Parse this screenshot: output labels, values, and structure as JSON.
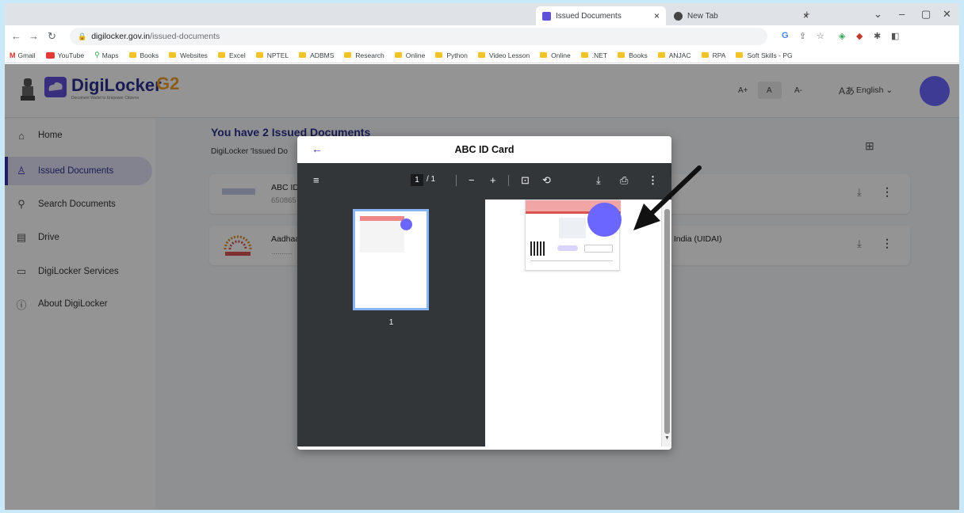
{
  "browser": {
    "tabs": [
      {
        "title": "Issued Documents",
        "favicon_color": "#5f52d9",
        "active": true
      },
      {
        "title": "New Tab",
        "favicon_color": "#444444",
        "active": false
      }
    ],
    "new_tab_label": "+",
    "url_host": "digilocker.gov.in",
    "url_path": "/issued-documents",
    "bookmarks": [
      {
        "label": "Gmail",
        "icon": "gmail-icon"
      },
      {
        "label": "YouTube",
        "icon": "youtube-icon"
      },
      {
        "label": "Maps",
        "icon": "maps-icon"
      },
      {
        "label": "Books",
        "icon": "folder-icon"
      },
      {
        "label": "Websites",
        "icon": "folder-icon"
      },
      {
        "label": "Excel",
        "icon": "folder-icon"
      },
      {
        "label": "NPTEL",
        "icon": "folder-icon"
      },
      {
        "label": "ADBMS",
        "icon": "folder-icon"
      },
      {
        "label": "Research",
        "icon": "folder-icon"
      },
      {
        "label": "Online",
        "icon": "folder-icon"
      },
      {
        "label": "Python",
        "icon": "folder-icon"
      },
      {
        "label": "Video Lesson",
        "icon": "folder-icon"
      },
      {
        "label": "Online",
        "icon": "folder-icon"
      },
      {
        "label": ".NET",
        "icon": "folder-icon"
      },
      {
        "label": "Books",
        "icon": "folder-icon"
      },
      {
        "label": "ANJAC",
        "icon": "folder-icon"
      },
      {
        "label": "RPA",
        "icon": "folder-icon"
      },
      {
        "label": "Soft Skills - PG",
        "icon": "folder-icon"
      }
    ]
  },
  "header": {
    "brand": "DigiLocker",
    "tagline": "Document Wallet to Empower Citizens",
    "g2c": "G2",
    "font_controls": [
      "A+",
      "A",
      "A-"
    ],
    "language": "English"
  },
  "sidebar": {
    "items": [
      {
        "label": "Home",
        "icon": "home-icon",
        "active": false
      },
      {
        "label": "Issued Documents",
        "icon": "issued-documents-icon",
        "active": true
      },
      {
        "label": "Search Documents",
        "icon": "search-icon",
        "active": false
      },
      {
        "label": "Drive",
        "icon": "drive-icon",
        "active": false
      },
      {
        "label": "DigiLocker Services",
        "icon": "services-icon",
        "active": false
      },
      {
        "label": "About DigiLocker",
        "icon": "info-icon",
        "active": false
      }
    ]
  },
  "main": {
    "title": "You have 2 Issued Documents",
    "subtitle": "DigiLocker 'Issued Do",
    "documents": [
      {
        "name": "ABC ID",
        "meta": "650865",
        "issuer": ""
      },
      {
        "name": "Aadhaa",
        "meta": "..........",
        "issuer": "f India (UIDAI)"
      }
    ]
  },
  "viewer": {
    "title": "ABC ID Card",
    "current_page": "1",
    "page_total": "/ 1",
    "thumbnail_label": "1"
  },
  "colors": {
    "accent": "#3b34a8",
    "highlight_dot": "#6a66ff",
    "pdf_toolbar": "#323639"
  }
}
